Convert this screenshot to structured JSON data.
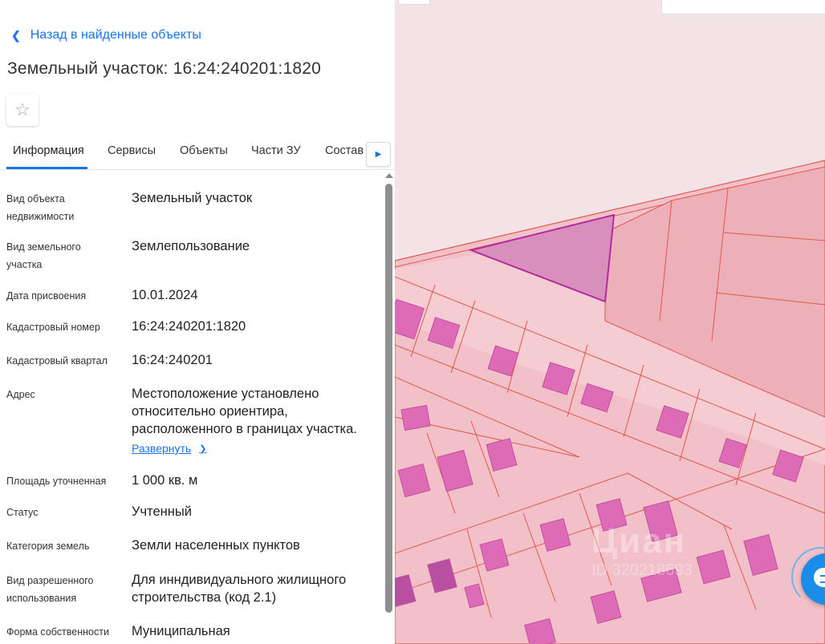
{
  "nav": {
    "back_label": "Назад в найденные объекты"
  },
  "header": {
    "title": "Земельный участок: 16:24:240201:1820"
  },
  "tabs": [
    {
      "label": "Информация"
    },
    {
      "label": "Сервисы"
    },
    {
      "label": "Объекты"
    },
    {
      "label": "Части ЗУ"
    },
    {
      "label": "Состав"
    }
  ],
  "info": {
    "rows": [
      {
        "label": "Вид объекта недвижимости",
        "value": "Земельный участок"
      },
      {
        "label": "Вид земельного участка",
        "value": "Землепользование"
      },
      {
        "label": "Дата присвоения",
        "value": "10.01.2024"
      },
      {
        "label": "Кадастровый номер",
        "value": "16:24:240201:1820"
      },
      {
        "label": "Кадастровый квартал",
        "value": "16:24:240201"
      },
      {
        "label": "Адрес",
        "value": "Местоположение установлено относительно ориентира, расположенного в границах участка."
      },
      {
        "label": "Площадь уточненная",
        "value": "1 000 кв. м"
      },
      {
        "label": "Статус",
        "value": "Учтенный"
      },
      {
        "label": "Категория земель",
        "value": "Земли населенных пунктов"
      },
      {
        "label": "Вид разрешенного использования",
        "value": "Для инндивидуального жилищного строительства (код 2.1)"
      },
      {
        "label": "Форма собственности",
        "value": "Муниципальная"
      }
    ],
    "expand_label": "Развернуть"
  },
  "map": {
    "watermark": "Циан",
    "watermark_id": "ID 320218693",
    "colors": {
      "parcel_fill": "#f2c0c8",
      "parcel_stroke": "#e2574a",
      "building_fill": "#dd6bb5",
      "selected_fill": "#d98fbb",
      "selected_stroke": "#b22aa0",
      "chat_button": "#1a8de8"
    }
  },
  "icons": {
    "back": "chevron-left-icon",
    "favorite": "star-outline-icon",
    "tabs_next": "caret-right-icon",
    "expand": "chevron-down-icon",
    "chat": "chat-icon"
  }
}
